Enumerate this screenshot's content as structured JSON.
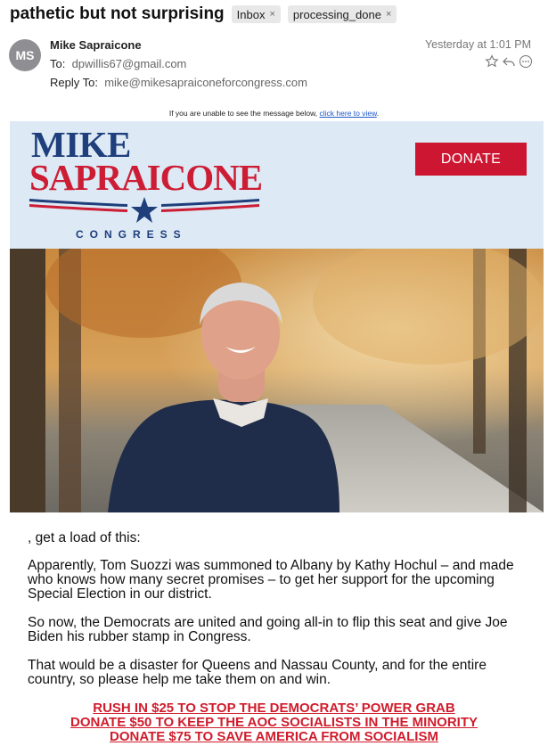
{
  "email": {
    "subject": "pathetic but not surprising",
    "tags": [
      {
        "label": "Inbox",
        "remove": "×"
      },
      {
        "label": "processing_done",
        "remove": "×"
      }
    ],
    "avatar_initials": "MS",
    "sender": "Mike Sapraicone",
    "to_label": "To:",
    "to_value": "dpwillis67@gmail.com",
    "reply_to_label": "Reply To:",
    "reply_to_value": "mike@mikesapraiconeforcongress.com",
    "date": "Yesterday at 1:01 PM",
    "actions": [
      "star-icon",
      "reply-icon",
      "more-icon"
    ]
  },
  "message": {
    "view_note": "If you are unable to see the message below, ",
    "view_link": "click here to view",
    "view_end": ".",
    "logo": {
      "line1": "MIKE",
      "line2": "SAPRAICONE",
      "line3": "CONGRESS"
    },
    "donate_label": "DONATE",
    "paragraphs": [
      ", get a load of this:",
      "Apparently, Tom Suozzi was summoned to Albany by Kathy Hochul – and made who knows how many secret promises – to get her support for the upcoming Special Election in our district.",
      "So now, the Democrats are united and going all-in to flip this seat and give Joe Biden his rubber stamp in Congress.",
      "That would be a disaster for Queens and Nassau County, and for the entire country, so please help me take them on and win."
    ],
    "cta_links": [
      "RUSH IN $25 TO STOP THE DEMOCRATS’ POWER GRAB",
      "DONATE $50 TO KEEP THE AOC SOCIALISTS IN THE MINORITY",
      "DONATE $75 TO SAVE AMERICA FROM SOCIALISM"
    ]
  },
  "colors": {
    "brand_blue": "#1e3f7c",
    "brand_red": "#cc1d35",
    "banner_bg": "#dde9f4",
    "link": "#1b57c8"
  }
}
